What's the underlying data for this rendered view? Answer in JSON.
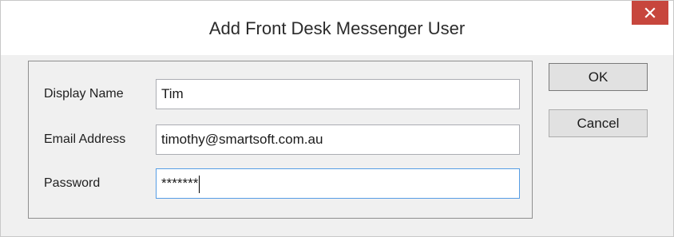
{
  "window": {
    "title": "Add Front Desk Messenger User",
    "close_icon": "close-icon",
    "close_color": "#c7463d"
  },
  "form": {
    "display_name": {
      "label": "Display Name",
      "value": "Tim"
    },
    "email_address": {
      "label": "Email Address",
      "value": "timothy@smartsoft.com.au"
    },
    "password": {
      "label": "Password",
      "value": "*******"
    }
  },
  "buttons": {
    "ok": "OK",
    "cancel": "Cancel"
  },
  "colors": {
    "focus_border": "#569de5",
    "dialog_background": "#f0f0f0"
  }
}
